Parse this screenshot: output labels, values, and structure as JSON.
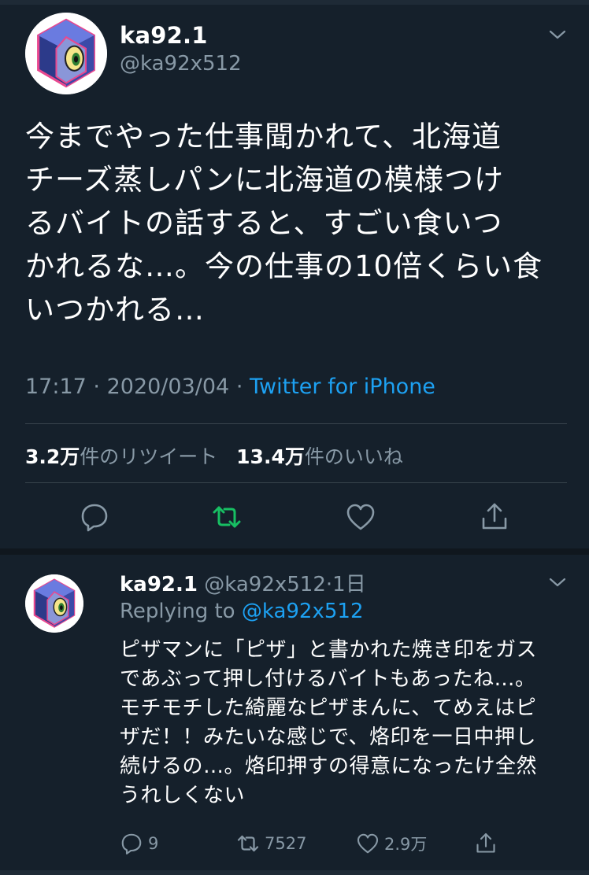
{
  "main_tweet": {
    "display_name": "ka92.1",
    "handle": "@ka92x512",
    "text_lines": [
      "今までやった仕事聞かれて、北海道",
      "チーズ蒸しパンに北海道の模様つけ",
      "るバイトの話すると、すごい食いつ",
      "かれるな…。今の仕事の10倍くらい食",
      "いつかれる…"
    ],
    "time": "17:17",
    "date": "2020/03/04",
    "dot": "·",
    "source": "Twitter for iPhone",
    "retweet_count": "3.2万",
    "retweet_label": "件のリツイート",
    "like_count": "13.4万",
    "like_label": "件のいいね"
  },
  "reply_tweet": {
    "display_name": "ka92.1",
    "handle": "@ka92x512",
    "age": "1日",
    "dot": "·",
    "replying_label": "Replying to",
    "replying_handle": "@ka92x512",
    "text_lines": [
      "ピザマンに「ピザ」と書かれた焼き印をガス",
      "であぶって押し付けるバイトもあったね…。",
      "モチモチした綺麗なピザまんに、てめえはピ",
      "ザだ！！みたいな感じで、烙印を一日中押し",
      "続けるの…。烙印押すの得意になったけ全然",
      "うれしくない"
    ],
    "reply_count": "9",
    "retweet_count": "7527",
    "like_count": "2.9万"
  },
  "icons": {
    "main_actions": [
      "reply-icon",
      "retweet-icon",
      "like-icon",
      "share-icon"
    ],
    "reply_actions": [
      "reply-icon",
      "retweet-icon",
      "like-icon",
      "share-icon"
    ],
    "menu": "chevron-down-icon",
    "avatar": "hexagon-eye-avatar"
  },
  "colors": {
    "background": "#15202b",
    "text": "#ffffff",
    "secondary_text": "#8899a6",
    "link": "#1da1f2",
    "retweet_green": "#17bf63",
    "divider": "#38444d"
  }
}
